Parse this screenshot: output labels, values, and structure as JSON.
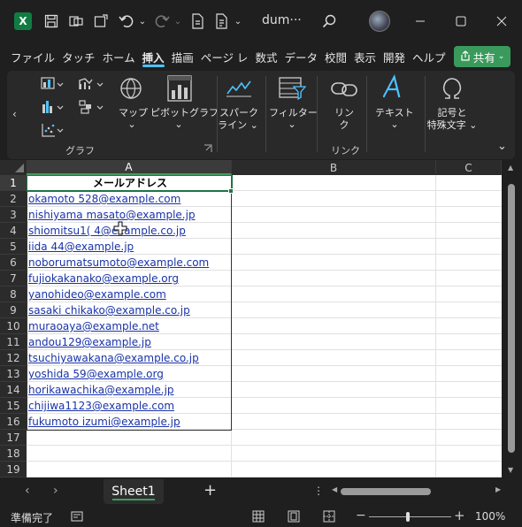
{
  "titlebar": {
    "app_icon": "excel-icon",
    "title": "dum···",
    "icons": [
      "save-icon",
      "touch-mode-icon",
      "form-icon",
      "undo-icon",
      "redo-icon",
      "file-icon",
      "file-icon-2",
      "search-icon",
      "minimize-icon",
      "maximize-icon",
      "close-icon"
    ]
  },
  "menu": {
    "tabs": [
      "ファイル",
      "タッチ",
      "ホーム",
      "挿入",
      "描画",
      "ページ レ",
      "数式",
      "データ",
      "校閲",
      "表示",
      "開発",
      "ヘルプ"
    ],
    "active_tab": "挿入",
    "share_label": "共有"
  },
  "ribbon": {
    "groups": {
      "chart": "グラフ",
      "link": "リンク"
    },
    "buttons": {
      "map": "マップ",
      "pivot_chart": "ピボットグラフ",
      "sparkline_1": "スパーク",
      "sparkline_2": "ライン",
      "filter": "フィルター",
      "link_1": "リン",
      "link_2": "ク",
      "text": "テキスト",
      "symbol_1": "記号と",
      "symbol_2": "特殊文字"
    }
  },
  "sheet": {
    "columns": [
      "A",
      "B",
      "C"
    ],
    "selected_column": "A",
    "rows": [
      "1",
      "2",
      "3",
      "4",
      "5",
      "6",
      "7",
      "8",
      "9",
      "10",
      "11",
      "12",
      "13",
      "14",
      "15",
      "16",
      "17",
      "18",
      "19"
    ],
    "header": "メールアドレス",
    "emails": [
      "okamoto 528@example.com",
      "nishiyama masato@example.jp",
      "shiomitsu1( 4@example.co.jp",
      "iida 44@example.jp",
      "noborumatsumoto@example.com",
      "fujiokakanako@example.org",
      "yanohideo@example.com",
      "sasaki chikako@example.co.jp",
      "muraoaya@example.net",
      "andou129@example.jp",
      "tsuchiyawakana@example.co.jp",
      "yoshida 59@example.org",
      "horikawachika@example.jp",
      "chijiwa1123@example.com",
      "fukumoto izumi@example.jp"
    ]
  },
  "sheet_tabs": {
    "active": "Sheet1"
  },
  "status": {
    "ready": "準備完了",
    "zoom": "100%"
  },
  "colors": {
    "accent": "#3f9c5e",
    "link": "#1a33a8",
    "tab_underline": "#4cc2ff"
  }
}
